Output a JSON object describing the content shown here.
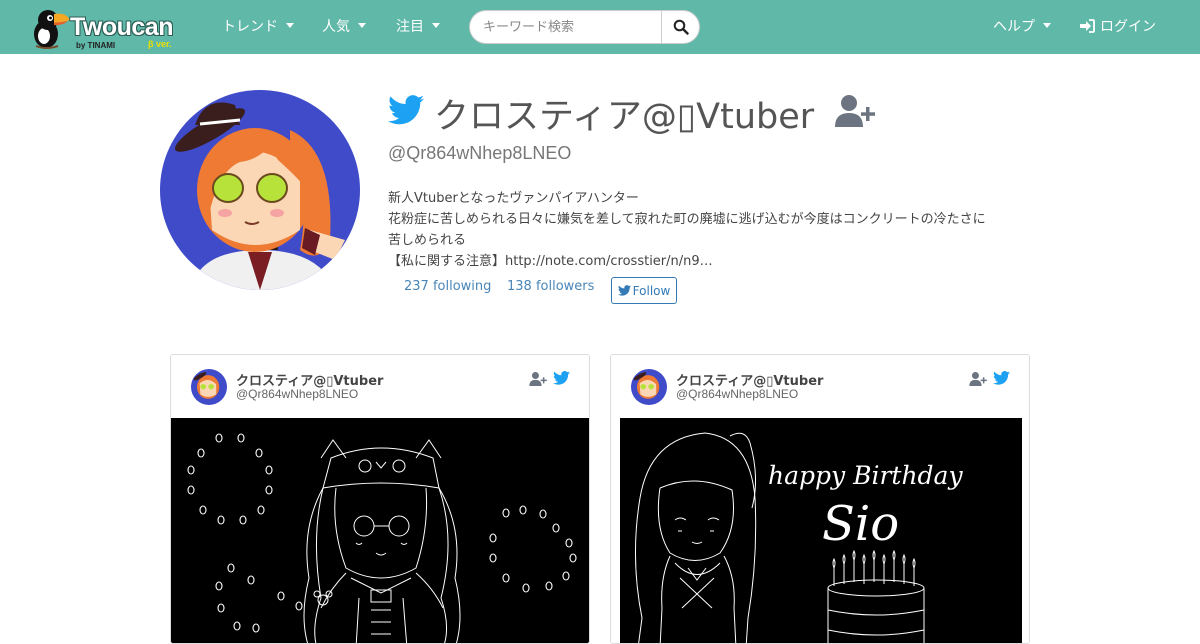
{
  "navbar": {
    "brand": {
      "name": "Twoucan",
      "sub": "by TINAMI",
      "beta": "β ver."
    },
    "menu": [
      {
        "label": "トレンド"
      },
      {
        "label": "人気"
      },
      {
        "label": "注目"
      }
    ],
    "search": {
      "placeholder": "キーワード検索",
      "value": ""
    },
    "help_label": "ヘルプ",
    "login_label": "ログイン"
  },
  "profile": {
    "name": "クロスティア@▯Vtuber",
    "handle": "@Qr864wNhep8LNEO",
    "bio": [
      "新人Vtuberとなったヴァンパイアハンター",
      "花粉症に苦しめられる日々に嫌気を差して寂れた町の廃墟に逃げ込むが今度はコンクリートの冷たさに",
      "苦しめられる",
      "【私に関する注意】http://note.com/crosstier/n/n9…"
    ],
    "following": "237 following",
    "followers": "138 followers",
    "follow_label": "Follow"
  },
  "cards": [
    {
      "name": "クロスティア@▯Vtuber",
      "handle": "@Qr864wNhep8LNEO",
      "image_icon": "chibi-line-art-icon"
    },
    {
      "name": "クロスティア@▯Vtuber",
      "handle": "@Qr864wNhep8LNEO",
      "image_text_1": "happy Birthday",
      "image_text_2": "Sio",
      "image_icon": "birthday-cake-icon"
    }
  ],
  "colors": {
    "navbar": "#5fb8a8",
    "twitter": "#1da1f2",
    "link": "#4a86b8",
    "avatar_bg": "#3f4bc9",
    "hair": "#ee7a34"
  }
}
